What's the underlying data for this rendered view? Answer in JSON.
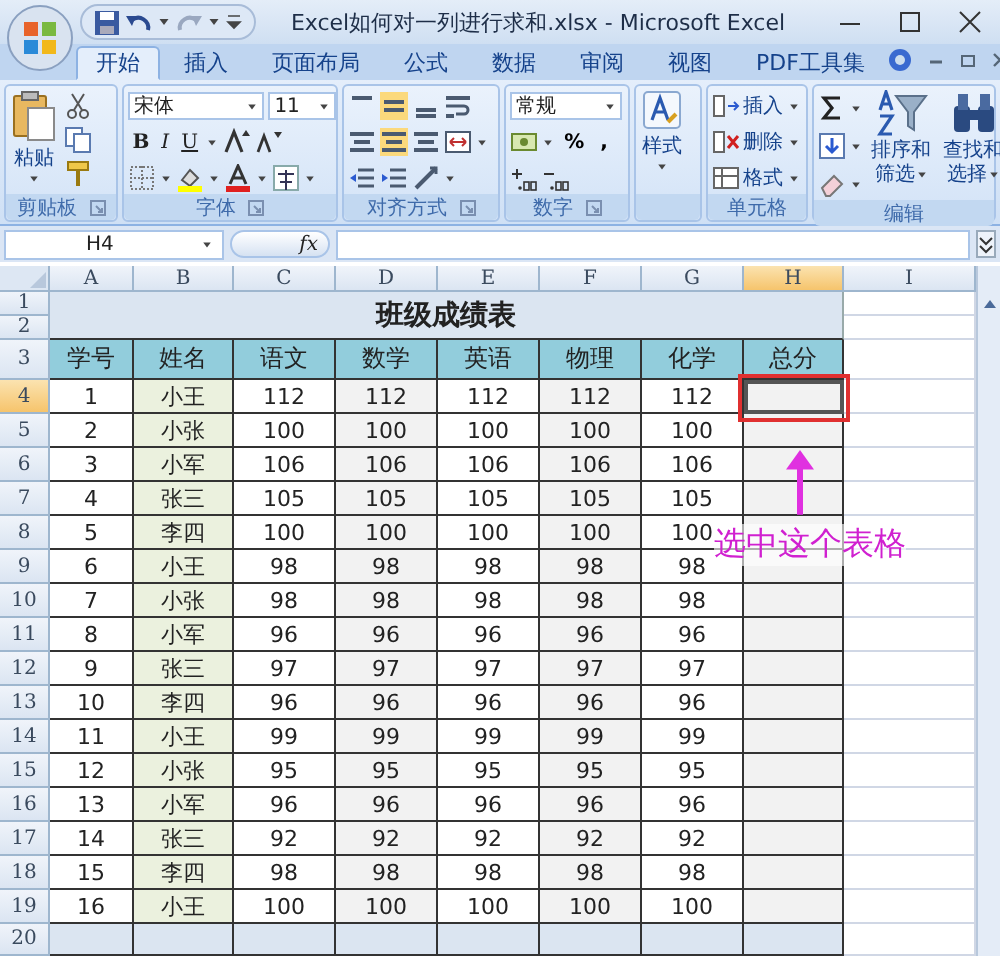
{
  "window": {
    "title": "Excel如何对一列进行求和.xlsx - Microsoft Excel"
  },
  "tabs": [
    {
      "label": "开始",
      "selected": true
    },
    {
      "label": "插入",
      "selected": false
    },
    {
      "label": "页面布局",
      "selected": false
    },
    {
      "label": "公式",
      "selected": false
    },
    {
      "label": "数据",
      "selected": false
    },
    {
      "label": "审阅",
      "selected": false
    },
    {
      "label": "视图",
      "selected": false
    },
    {
      "label": "PDF工具集",
      "selected": false
    }
  ],
  "ribbon": {
    "clipboard": {
      "paste": "粘贴",
      "label": "剪贴板"
    },
    "font": {
      "font_name": "宋体",
      "font_size": "11",
      "format_buttons": [
        "B",
        "I",
        "U"
      ],
      "label": "字体"
    },
    "alignment": {
      "label": "对齐方式"
    },
    "number": {
      "format": "常规",
      "symbols": [
        "%",
        ","
      ],
      "label": "数字"
    },
    "styles": {
      "button": "样式"
    },
    "cells": {
      "buttons": [
        "插入",
        "删除",
        "格式"
      ],
      "label": "单元格"
    },
    "editing": {
      "buttons": [
        "排序和筛选",
        "查找和选择"
      ],
      "label": "编辑"
    }
  },
  "formula_bar": {
    "name_box": "H4",
    "function_label": "fx"
  },
  "sheet": {
    "columns": [
      {
        "label": "A",
        "selected": false
      },
      {
        "label": "B",
        "selected": false
      },
      {
        "label": "C",
        "selected": false
      },
      {
        "label": "D",
        "selected": false
      },
      {
        "label": "E",
        "selected": false
      },
      {
        "label": "F",
        "selected": false
      },
      {
        "label": "G",
        "selected": false
      },
      {
        "label": "H",
        "selected": true
      },
      {
        "label": "I",
        "selected": false
      }
    ],
    "row_headers": [
      {
        "label": "1",
        "selected": false
      },
      {
        "label": "2",
        "selected": false
      },
      {
        "label": "3",
        "selected": false
      },
      {
        "label": "4",
        "selected": true
      },
      {
        "label": "5",
        "selected": false
      },
      {
        "label": "6",
        "selected": false
      },
      {
        "label": "7",
        "selected": false
      },
      {
        "label": "8",
        "selected": false
      },
      {
        "label": "9",
        "selected": false
      },
      {
        "label": "10",
        "selected": false
      },
      {
        "label": "11",
        "selected": false
      },
      {
        "label": "12",
        "selected": false
      },
      {
        "label": "13",
        "selected": false
      },
      {
        "label": "14",
        "selected": false
      },
      {
        "label": "15",
        "selected": false
      },
      {
        "label": "16",
        "selected": false
      },
      {
        "label": "17",
        "selected": false
      },
      {
        "label": "18",
        "selected": false
      },
      {
        "label": "19",
        "selected": false
      },
      {
        "label": "20",
        "selected": false
      }
    ],
    "title": "班级成绩表",
    "headers": [
      "学号",
      "姓名",
      "语文",
      "数学",
      "英语",
      "物理",
      "化学",
      "总分"
    ],
    "rows": [
      {
        "cells": [
          "1",
          "小王",
          "112",
          "112",
          "112",
          "112",
          "112"
        ]
      },
      {
        "cells": [
          "2",
          "小张",
          "100",
          "100",
          "100",
          "100",
          "100"
        ]
      },
      {
        "cells": [
          "3",
          "小军",
          "106",
          "106",
          "106",
          "106",
          "106"
        ]
      },
      {
        "cells": [
          "4",
          "张三",
          "105",
          "105",
          "105",
          "105",
          "105"
        ]
      },
      {
        "cells": [
          "5",
          "李四",
          "100",
          "100",
          "100",
          "100",
          "100"
        ]
      },
      {
        "cells": [
          "6",
          "小王",
          "98",
          "98",
          "98",
          "98",
          "98"
        ]
      },
      {
        "cells": [
          "7",
          "小张",
          "98",
          "98",
          "98",
          "98",
          "98"
        ]
      },
      {
        "cells": [
          "8",
          "小军",
          "96",
          "96",
          "96",
          "96",
          "96"
        ]
      },
      {
        "cells": [
          "9",
          "张三",
          "97",
          "97",
          "97",
          "97",
          "97"
        ]
      },
      {
        "cells": [
          "10",
          "李四",
          "96",
          "96",
          "96",
          "96",
          "96"
        ]
      },
      {
        "cells": [
          "11",
          "小王",
          "99",
          "99",
          "99",
          "99",
          "99"
        ]
      },
      {
        "cells": [
          "12",
          "小张",
          "95",
          "95",
          "95",
          "95",
          "95"
        ]
      },
      {
        "cells": [
          "13",
          "小军",
          "96",
          "96",
          "96",
          "96",
          "96"
        ]
      },
      {
        "cells": [
          "14",
          "张三",
          "92",
          "92",
          "92",
          "92",
          "92"
        ]
      },
      {
        "cells": [
          "15",
          "李四",
          "98",
          "98",
          "98",
          "98",
          "98"
        ]
      },
      {
        "cells": [
          "16",
          "小王",
          "100",
          "100",
          "100",
          "100",
          "100"
        ]
      }
    ]
  },
  "annotation": {
    "text": "选中这个表格"
  }
}
